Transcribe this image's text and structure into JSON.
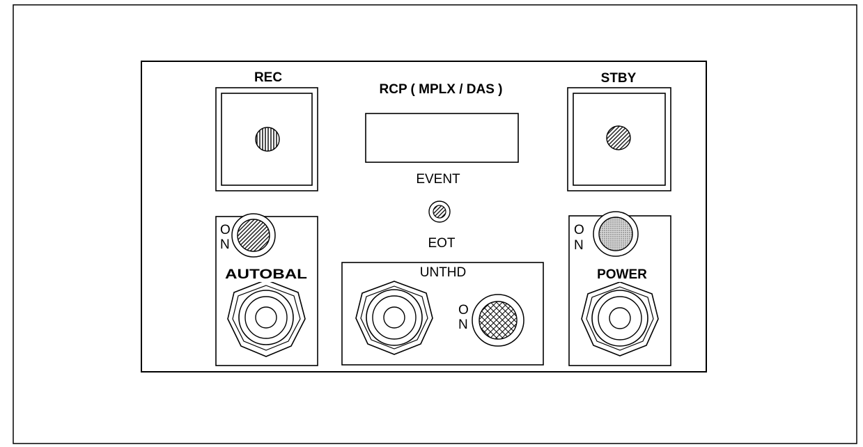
{
  "panel": {
    "title": "RCP ( MPLX / DAS )",
    "rec_label": "REC",
    "stby_label": "STBY",
    "event_label": "EVENT",
    "eot_label": "EOT",
    "autobal_label": "AUTOBAL",
    "unthd_label": "UNTHD",
    "power_label": "POWER",
    "on_o": "O",
    "on_n": "N"
  },
  "colors": {
    "line": "#000000",
    "background": "#ffffff",
    "power_led_fill": "#bdbdbd"
  },
  "icons": {
    "rec_led": "vertical-hatch-indicator",
    "stby_led": "diagonal-hatch-indicator",
    "event_led": "diagonal-hatch-indicator",
    "autobal_led": "diagonal-hatch-indicator",
    "power_led": "stipple-indicator",
    "unthd_led": "crosshatch-indicator",
    "switches": "hex-nut-switch"
  }
}
